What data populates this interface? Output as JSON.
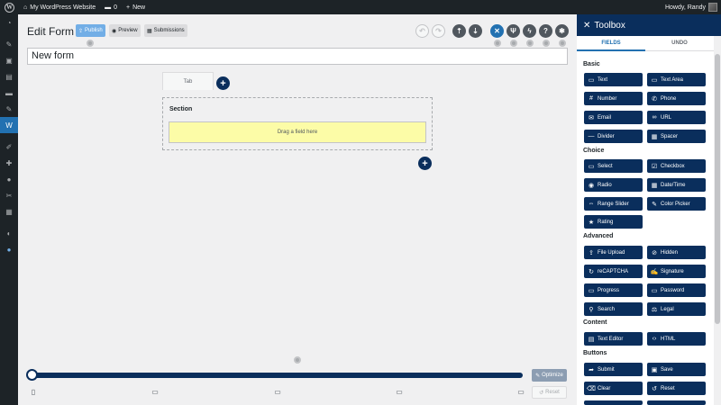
{
  "adminbar": {
    "site_name": "My WordPress Website",
    "comments_count": "0",
    "new_label": "New",
    "howdy": "Howdy, Randy"
  },
  "adminmenu": {
    "icons": [
      "dashboard-icon",
      "pin-icon",
      "media-icon",
      "pages-icon",
      "comments-icon",
      "pin-icon",
      "forms-icon",
      "appearance-icon",
      "plugins-icon",
      "users-icon",
      "tools-icon",
      "settings-icon",
      "gauge-icon",
      "circle-icon"
    ],
    "active_label": "W"
  },
  "editor": {
    "title": "Edit Form",
    "publish": "Publish",
    "preview": "Preview",
    "submissions": "Submissions",
    "form_name": "New form",
    "tab_label": "Tab",
    "section_label": "Section",
    "dropzone_text": "Drag a field here",
    "optimize": "Optimize",
    "reset": "Reset"
  },
  "toolbox": {
    "title": "Toolbox",
    "tabs": [
      "FIELDS",
      "UNDO"
    ],
    "categories": {
      "basic": "Basic",
      "choice": "Choice",
      "advanced": "Advanced",
      "content": "Content",
      "buttons": "Buttons"
    },
    "fields": {
      "text": "Text",
      "text_area": "Text Area",
      "number": "Number",
      "phone": "Phone",
      "email": "Email",
      "url": "URL",
      "divider": "Divider",
      "spacer": "Spacer",
      "select": "Select",
      "checkbox": "Checkbox",
      "radio": "Radio",
      "date_time": "Date/Time",
      "range_slider": "Range Slider",
      "color_picker": "Color Picker",
      "rating": "Rating",
      "file_upload": "File Upload",
      "hidden": "Hidden",
      "recaptcha": "reCAPTCHA",
      "signature": "Signature",
      "progress": "Progress",
      "password": "Password",
      "search": "Search",
      "legal": "Legal",
      "text_editor": "Text Editor",
      "html": "HTML",
      "submit": "Submit",
      "save": "Save",
      "clear": "Clear",
      "reset": "Reset"
    }
  },
  "colors": {
    "navy": "#0a2e5c",
    "admin_dark": "#1d2327",
    "accent_blue": "#2271b1",
    "dropzone": "#fcfca7"
  }
}
